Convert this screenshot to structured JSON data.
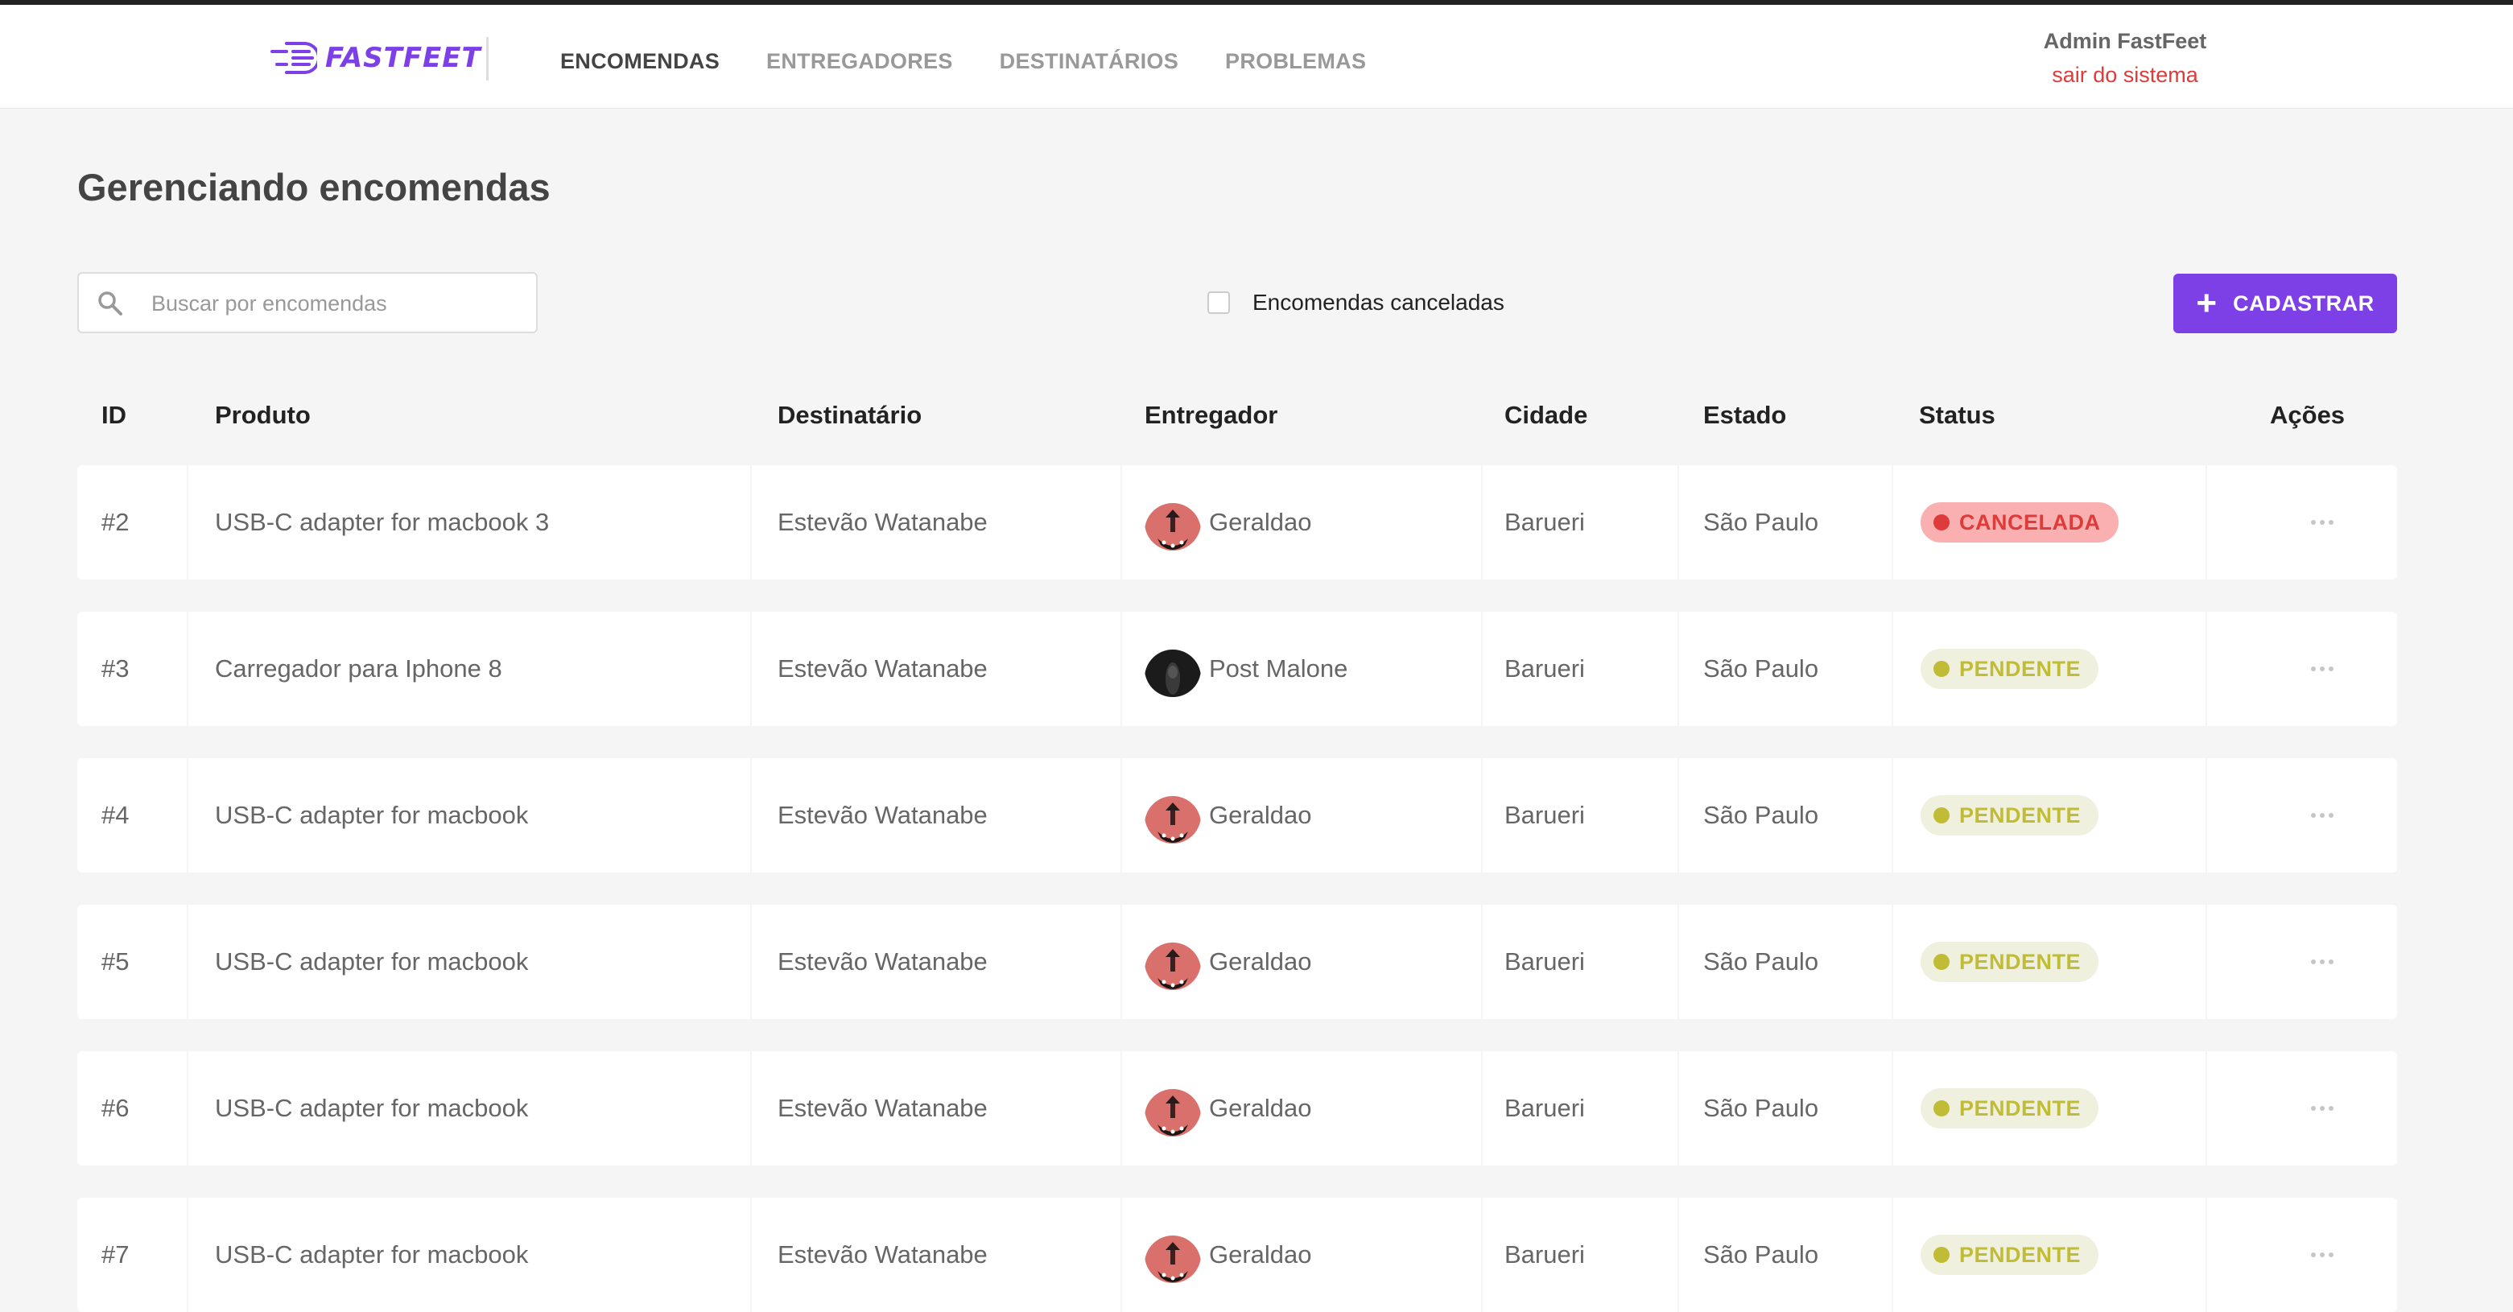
{
  "header": {
    "logo_text": "FASTFEET",
    "nav": [
      {
        "label": "ENCOMENDAS",
        "active": true
      },
      {
        "label": "ENTREGADORES",
        "active": false
      },
      {
        "label": "DESTINATÁRIOS",
        "active": false
      },
      {
        "label": "PROBLEMAS",
        "active": false
      }
    ],
    "user_name": "Admin FastFeet",
    "logout_label": "sair do sistema"
  },
  "page": {
    "title": "Gerenciando encomendas",
    "search_placeholder": "Buscar por encomendas",
    "filter_label": "Encomendas canceladas",
    "filter_checked": false,
    "add_button_label": "CADASTRAR"
  },
  "table": {
    "columns": [
      "ID",
      "Produto",
      "Destinatário",
      "Entregador",
      "Cidade",
      "Estado",
      "Status",
      "Ações"
    ],
    "rows": [
      {
        "id": "#2",
        "product": "USB-C adapter for macbook 3",
        "recipient": "Estevão Watanabe",
        "courier": "Geraldao",
        "avatar": "pink",
        "city": "Barueri",
        "state": "São Paulo",
        "status": "CANCELADA"
      },
      {
        "id": "#3",
        "product": "Carregador para Iphone 8",
        "recipient": "Estevão Watanabe",
        "courier": "Post Malone",
        "avatar": "dark",
        "city": "Barueri",
        "state": "São Paulo",
        "status": "PENDENTE"
      },
      {
        "id": "#4",
        "product": "USB-C adapter for macbook",
        "recipient": "Estevão Watanabe",
        "courier": "Geraldao",
        "avatar": "pink",
        "city": "Barueri",
        "state": "São Paulo",
        "status": "PENDENTE"
      },
      {
        "id": "#5",
        "product": "USB-C adapter for macbook",
        "recipient": "Estevão Watanabe",
        "courier": "Geraldao",
        "avatar": "pink",
        "city": "Barueri",
        "state": "São Paulo",
        "status": "PENDENTE"
      },
      {
        "id": "#6",
        "product": "USB-C adapter for macbook",
        "recipient": "Estevão Watanabe",
        "courier": "Geraldao",
        "avatar": "pink",
        "city": "Barueri",
        "state": "São Paulo",
        "status": "PENDENTE"
      },
      {
        "id": "#7",
        "product": "USB-C adapter for macbook",
        "recipient": "Estevão Watanabe",
        "courier": "Geraldao",
        "avatar": "pink",
        "city": "Barueri",
        "state": "São Paulo",
        "status": "PENDENTE"
      }
    ]
  },
  "status_colors": {
    "CANCELADA": {
      "bg": "#fab0b0",
      "fg": "#de3b3b"
    },
    "PENDENTE": {
      "bg": "#f0f0df",
      "fg": "#c1bc35"
    }
  },
  "colors": {
    "accent": "#7d40e7",
    "background": "#f5f5f5"
  }
}
